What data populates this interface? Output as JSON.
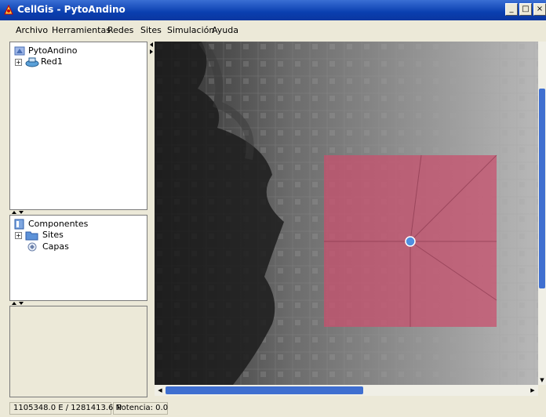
{
  "window": {
    "title": "CellGis - PytoAndino",
    "controls": [
      "_",
      "□",
      "×"
    ]
  },
  "menu": [
    "Archivo",
    "Herramientas",
    "Redes",
    "Sites",
    "Simulación",
    "Ayuda"
  ],
  "network_tree": {
    "root": "PytoAndino",
    "children": [
      "Red1"
    ]
  },
  "components_tree": {
    "root": "Componentes",
    "children": [
      "Sites",
      "Capas"
    ]
  },
  "map": {
    "coverage_color": "#c8506e",
    "site_color": "#4f8fe0"
  },
  "status": {
    "coordinates": "1105348.0 E / 1281413.6 N",
    "potencia_label": "Potencia:",
    "potencia_value": "0.0"
  },
  "colors": {
    "titlebar": "#0a3fb0",
    "scrollbar_thumb": "#3f6fd0"
  }
}
